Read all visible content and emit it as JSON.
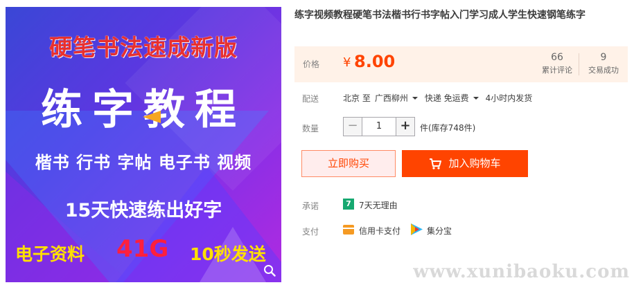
{
  "product_image": {
    "headline": "硬笔书法速成新版",
    "main_title": "练字教程",
    "categories": "楷书 行书 字帖 电子书 视频",
    "promise": "15天快速练出好字",
    "bottom_left": "电子资料",
    "bottom_size": "41G",
    "bottom_right": "10秒发送"
  },
  "title": "练字视频教程硬笔书法楷书行书字帖入门学习成人学生快速钢笔练字",
  "price": {
    "label": "价格",
    "symbol": "¥",
    "value": "8.00"
  },
  "stats": {
    "reviews_count": "66",
    "reviews_label": "累计评论",
    "trades_count": "9",
    "trades_label": "交易成功"
  },
  "shipping": {
    "label": "配送",
    "from": "北京 至",
    "to": "广西柳州",
    "method": "快递 免运费",
    "dispatch": "4小时内发货"
  },
  "quantity": {
    "label": "数量",
    "minus": "−",
    "value": "1",
    "plus": "+",
    "stock": "件(库存748件)"
  },
  "buttons": {
    "buy_now": "立即购买",
    "add_to_cart": "加入购物车"
  },
  "promise": {
    "label": "承诺",
    "icon_text": "7",
    "text": "7天无理由"
  },
  "payment": {
    "label": "支付",
    "credit_card": "信用卡支付",
    "jifenbao": "集分宝"
  },
  "watermark": "www.xunibaoku.com",
  "colors": {
    "accent": "#ff4400",
    "price_bg": "#fff2e8",
    "promise_green": "#16a870"
  }
}
